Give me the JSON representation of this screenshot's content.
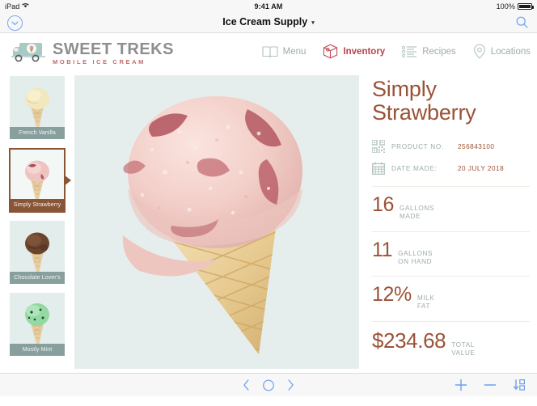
{
  "status_bar": {
    "device": "iPad",
    "wifi_icon": "wifi-icon",
    "time": "9:41 AM",
    "battery_percent": "100%",
    "battery_icon": "battery-full-icon"
  },
  "title_bar": {
    "back_icon": "chevron-down-circle-icon",
    "title": "Ice Cream Supply",
    "caret": "▾",
    "search_icon": "search-icon",
    "progress_color": "#a83f5b"
  },
  "brand": {
    "truck_icon": "ice-cream-truck-icon",
    "name": "SWEET TREKS",
    "tagline": "MOBILE ICE CREAM",
    "name_color": "#8e8e8e",
    "tagline_color": "#bd6d6d"
  },
  "nav_tabs": [
    {
      "label": "Menu",
      "icon": "book-icon",
      "active": false
    },
    {
      "label": "Inventory",
      "icon": "box-icon",
      "active": true
    },
    {
      "label": "Recipes",
      "icon": "list-icon",
      "active": false
    },
    {
      "label": "Locations",
      "icon": "map-pin-icon",
      "active": false
    }
  ],
  "sidebar": {
    "items": [
      {
        "label": "French Vanilla",
        "selected": false
      },
      {
        "label": "Simply Strawberry",
        "selected": true
      },
      {
        "label": "Chocolate Lover's",
        "selected": false
      },
      {
        "label": "Mostly Mint",
        "selected": false
      }
    ]
  },
  "main_image": {
    "alt": "strawberry-ice-cream-cone-photo",
    "background": "#e6eeed"
  },
  "detail": {
    "title_line1": "Simply",
    "title_line2": "Strawberry",
    "accent_color": "#9b5236",
    "meta": [
      {
        "icon": "qr-code-icon",
        "label": "PRODUCT NO:",
        "value": "256843100"
      },
      {
        "icon": "calendar-icon",
        "label": "DATE MADE:",
        "value": "20 JULY 2018"
      }
    ],
    "stats": [
      {
        "value": "16",
        "label": "GALLONS\nMADE"
      },
      {
        "value": "11",
        "label": "GALLONS\nON HAND"
      },
      {
        "value": "12%",
        "label": "MILK\nFAT"
      },
      {
        "value": "$234.68",
        "label": "TOTAL\nVALUE"
      }
    ]
  },
  "toolbar": {
    "prev_icon": "chevron-left-icon",
    "circle_icon": "circle-icon",
    "next_icon": "chevron-right-icon",
    "add_icon": "plus-icon",
    "remove_icon": "minus-icon",
    "sort_icon": "sort-a-z-icon"
  }
}
